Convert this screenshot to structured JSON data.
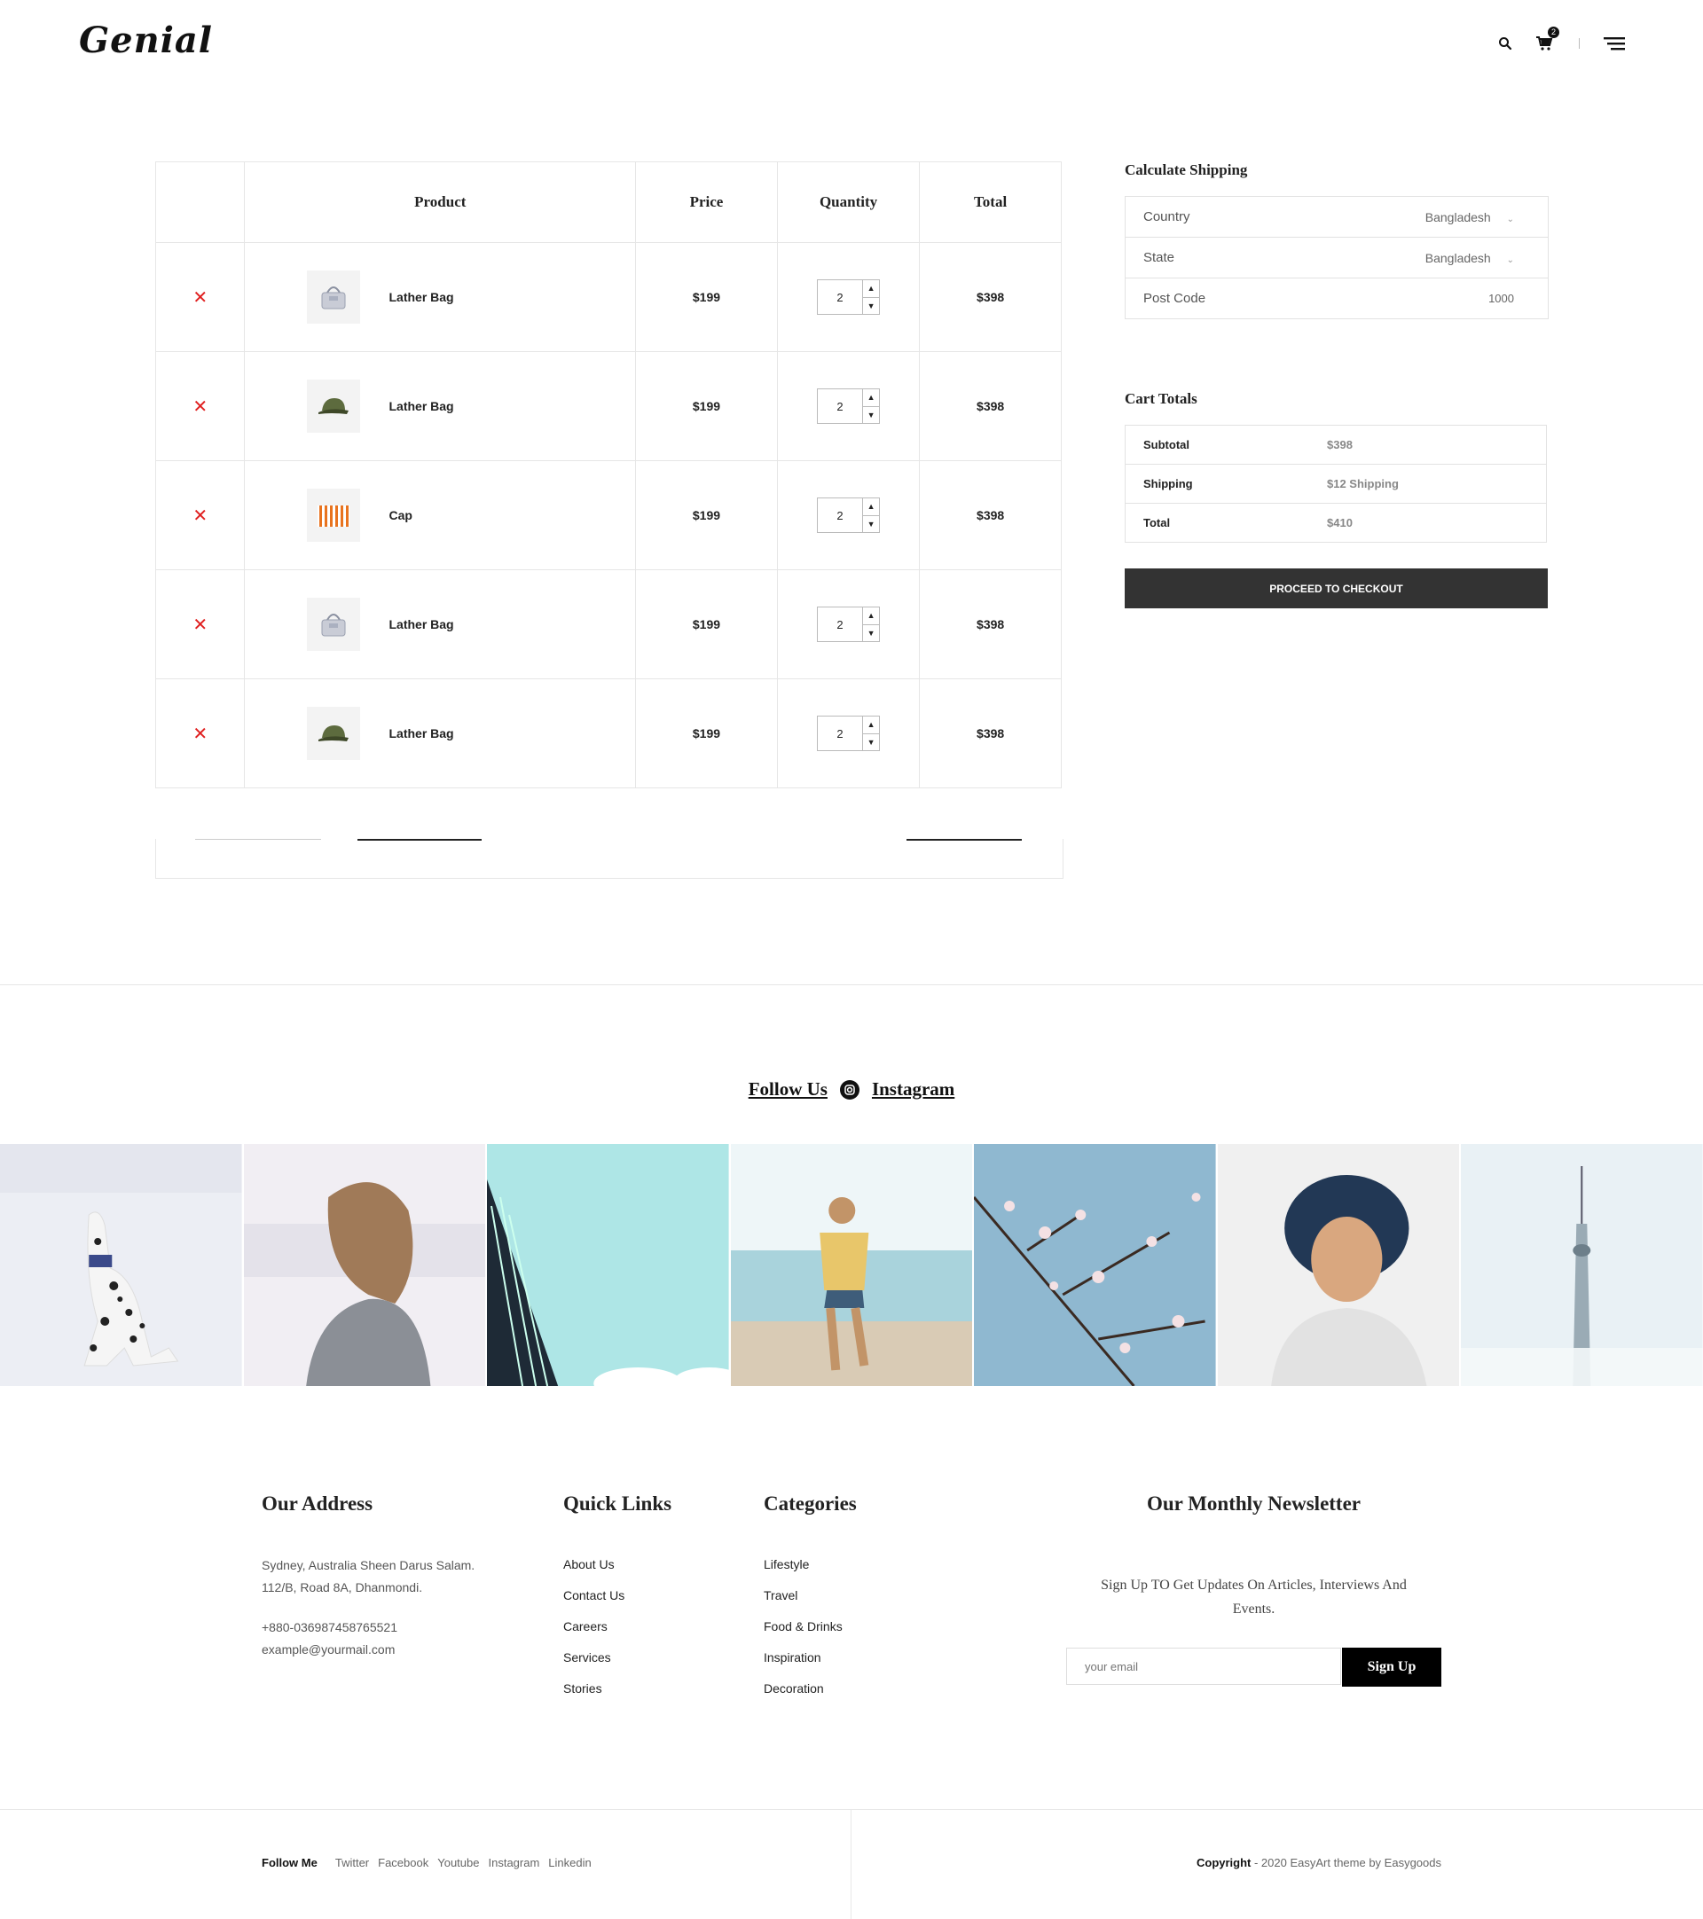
{
  "header": {
    "logo": "Genial",
    "cart_count": "2"
  },
  "cart": {
    "headers": [
      "Product",
      "Price",
      "Quantity",
      "Total"
    ],
    "items": [
      {
        "name": "Lather Bag",
        "price": "$199",
        "qty": "2",
        "total": "$398",
        "icon": "bag-icon"
      },
      {
        "name": "Lather Bag",
        "price": "$199",
        "qty": "2",
        "total": "$398",
        "icon": "cap-icon"
      },
      {
        "name": "Cap",
        "price": "$199",
        "qty": "2",
        "total": "$398",
        "icon": "striped-bag-icon"
      },
      {
        "name": "Lather Bag",
        "price": "$199",
        "qty": "2",
        "total": "$398",
        "icon": "bag-icon"
      },
      {
        "name": "Lather Bag",
        "price": "$199",
        "qty": "2",
        "total": "$398",
        "icon": "cap-icon"
      }
    ]
  },
  "shipping": {
    "title": "Calculate Shipping",
    "country_label": "Country",
    "country_value": "Bangladesh",
    "state_label": "State",
    "state_value": "Bangladesh",
    "postcode_label": "Post Code",
    "postcode_value": "1000"
  },
  "totals": {
    "title": "Cart Totals",
    "subtotal_label": "Subtotal",
    "subtotal_value": "$398",
    "shipping_label": "Shipping",
    "shipping_value": "$12 Shipping",
    "total_label": "Total",
    "total_value": "$410",
    "checkout_label": "PROCEED TO CHECKOUT"
  },
  "instagram": {
    "follow_label": "Follow Us",
    "platform_label": "Instagram"
  },
  "footer": {
    "address_title": "Our Address",
    "address_line1": "Sydney, Australia Sheen Darus Salam.",
    "address_line2": "112/B, Road 8A, Dhanmondi.",
    "phone": "+880-036987458765521",
    "email": "example@yourmail.com",
    "quick_links_title": "Quick Links",
    "quick_links": [
      "About Us",
      "Contact Us",
      "Careers",
      "Services",
      "Stories"
    ],
    "categories_title": "Categories",
    "categories": [
      "Lifestyle",
      "Travel",
      "Food & Drinks",
      "Inspiration",
      "Decoration"
    ],
    "newsletter_title": "Our Monthly Newsletter",
    "newsletter_line1": "Sign Up TO Get Updates On Articles, Interviews And",
    "newsletter_line2": "Events.",
    "email_placeholder": "your email",
    "signup_label": "Sign Up"
  },
  "bottom": {
    "follow_me": "Follow Me",
    "social": [
      "Twitter",
      "Facebook",
      "Youtube",
      "Instagram",
      "Linkedin"
    ],
    "copyright_bold": "Copyright",
    "copyright_text": " - 2020 EasyArt theme by Easygoods"
  },
  "colors": {
    "remove": "#e02020",
    "checkout_bg": "#333333",
    "signup_bg": "#000000"
  }
}
